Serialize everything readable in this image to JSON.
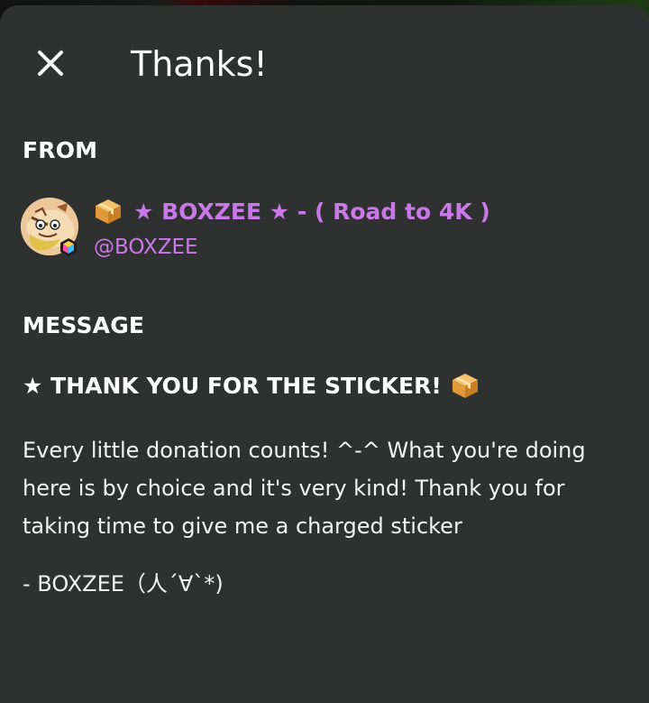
{
  "header": {
    "title": "Thanks!",
    "close_icon": "close-icon"
  },
  "from": {
    "label": "FROM",
    "sender_name": "★ BOXZEE ★ - ( Road to 4K )",
    "sender_handle": "@BOXZEE",
    "name_color": "#c978e8",
    "avatar_icon": "avatar-cartoon-icon",
    "badge_icon": "hexagon-badge-icon",
    "name_prefix_icon": "package-icon"
  },
  "message": {
    "label": "MESSAGE",
    "heading": "★ THANK YOU FOR THE STICKER!",
    "heading_suffix_icon": "package-icon",
    "body": "Every little donation counts! ^-^ What you're doing here is by choice and it's very kind! Thank you for taking time to give me a charged sticker",
    "signature": "- BOXZEE（人´∀`*)"
  },
  "colors": {
    "sheet_background": "#2f3130",
    "text": "#ffffff",
    "accent_purple": "#c978e8"
  }
}
